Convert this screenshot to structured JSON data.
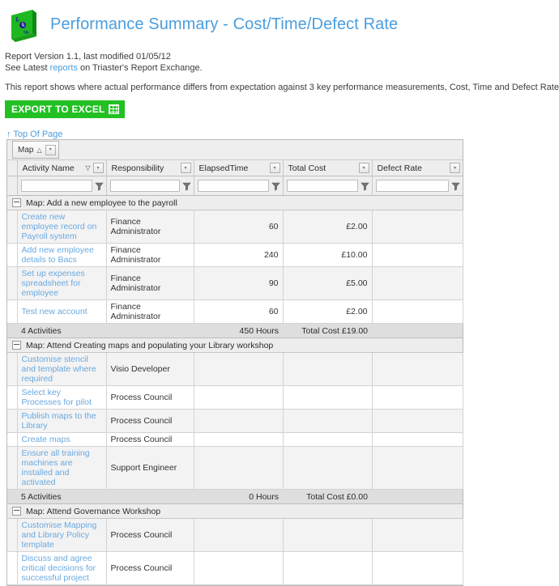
{
  "header": {
    "icon": "performance-card-icon",
    "title": "Performance Summary - Cost/Time/Defect Rate"
  },
  "meta": {
    "version_line": "Report Version 1.1, last modified 01/05/12",
    "latest_prefix": "See Latest ",
    "latest_link": "reports",
    "latest_suffix": " on Triaster's Report Exchange.",
    "description": "This report shows where actual performance differs from expectation against 3 key performance measurements, Cost, Time and Defect Rate against an activity"
  },
  "toolbar": {
    "export_label": "EXPORT TO EXCEL",
    "export_icon": "excel-grid-icon",
    "accent_color": "#22c022"
  },
  "top_of_page": {
    "arrow": "↑",
    "label": "Top Of Page"
  },
  "grid": {
    "group_chip": {
      "label": "Map",
      "sort_glyph": "△",
      "dropdown_glyph": "▾"
    },
    "columns": [
      {
        "key": "activity_name",
        "label": "Activity Name",
        "sorted": "desc",
        "sort_glyph": "▽",
        "filter_value": "",
        "filter_placeholder": ""
      },
      {
        "key": "responsibility",
        "label": "Responsibility",
        "sorted": "",
        "sort_glyph": "",
        "filter_value": "",
        "filter_placeholder": ""
      },
      {
        "key": "elapsed_time",
        "label": "ElapsedTime",
        "sorted": "",
        "sort_glyph": "",
        "filter_value": "",
        "filter_placeholder": ""
      },
      {
        "key": "total_cost",
        "label": "Total Cost",
        "sorted": "",
        "sort_glyph": "",
        "filter_value": "",
        "filter_placeholder": ""
      },
      {
        "key": "defect_rate",
        "label": "Defect Rate",
        "sorted": "",
        "sort_glyph": "",
        "filter_value": "",
        "filter_placeholder": ""
      }
    ],
    "groups": [
      {
        "title": "Map: Add a new employee to the payroll",
        "rows": [
          {
            "activity_name": "Create new employee record on Payroll system",
            "responsibility": "Finance Administrator",
            "elapsed_time": "60",
            "total_cost": "£2.00",
            "defect_rate": ""
          },
          {
            "activity_name": "Add new employee details to Bacs",
            "responsibility": "Finance Administrator",
            "elapsed_time": "240",
            "total_cost": "£10.00",
            "defect_rate": ""
          },
          {
            "activity_name": "Set up expenses spreadsheet for employee",
            "responsibility": "Finance Administrator",
            "elapsed_time": "90",
            "total_cost": "£5.00",
            "defect_rate": ""
          },
          {
            "activity_name": "Test new account",
            "responsibility": "Finance Administrator",
            "elapsed_time": "60",
            "total_cost": "£2.00",
            "defect_rate": ""
          }
        ],
        "summary": {
          "count_label": "4 Activities",
          "hours_label": "450 Hours",
          "cost_label": "Total Cost £19.00"
        }
      },
      {
        "title": "Map: Attend Creating maps and populating your Library workshop",
        "rows": [
          {
            "activity_name": "Customise stencil and template where required",
            "responsibility": "Visio Developer",
            "elapsed_time": "",
            "total_cost": "",
            "defect_rate": ""
          },
          {
            "activity_name": "Select key Processes for pilot",
            "responsibility": "Process Council",
            "elapsed_time": "",
            "total_cost": "",
            "defect_rate": ""
          },
          {
            "activity_name": "Publish maps to the Library",
            "responsibility": "Process Council",
            "elapsed_time": "",
            "total_cost": "",
            "defect_rate": ""
          },
          {
            "activity_name": "Create maps",
            "responsibility": "Process Council",
            "elapsed_time": "",
            "total_cost": "",
            "defect_rate": ""
          },
          {
            "activity_name": "Ensure all training machines are installed and activated",
            "responsibility": "Support Engineer",
            "elapsed_time": "",
            "total_cost": "",
            "defect_rate": ""
          }
        ],
        "summary": {
          "count_label": "5 Activities",
          "hours_label": "0 Hours",
          "cost_label": "Total Cost £0.00"
        }
      },
      {
        "title": "Map: Attend Governance Workshop",
        "rows": [
          {
            "activity_name": "Customise Mapping and Library Policy template",
            "responsibility": "Process Council",
            "elapsed_time": "",
            "total_cost": "",
            "defect_rate": ""
          },
          {
            "activity_name": "Discuss and agree critical decisions for successful project",
            "responsibility": "Process Council",
            "elapsed_time": "",
            "total_cost": "",
            "defect_rate": ""
          }
        ],
        "summary": null
      }
    ]
  }
}
